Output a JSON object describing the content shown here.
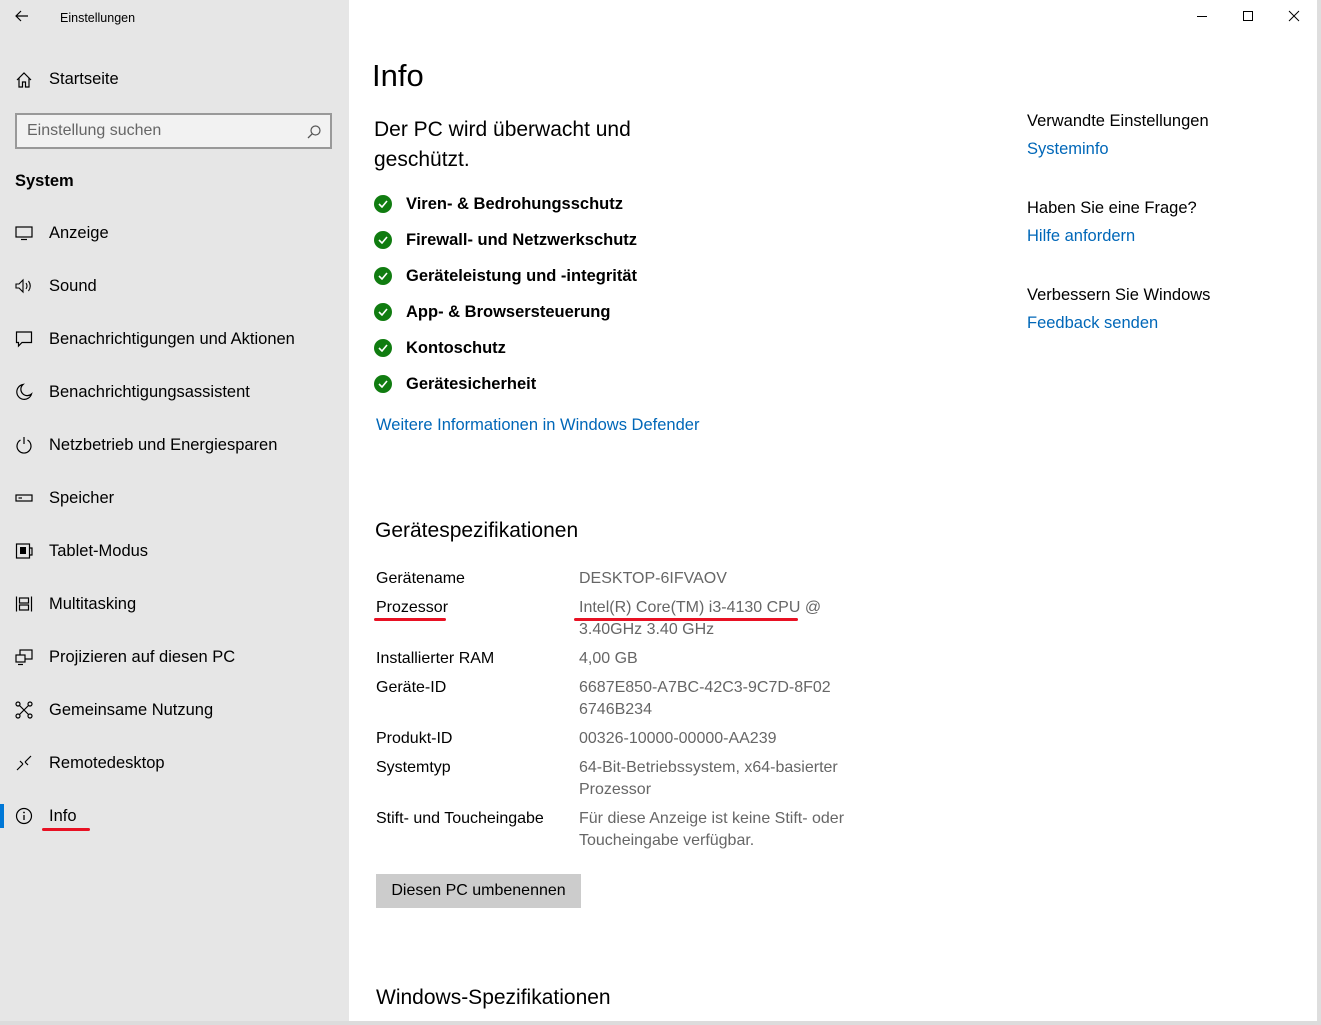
{
  "window": {
    "title": "Einstellungen"
  },
  "sidebar": {
    "home_label": "Startseite",
    "search_placeholder": "Einstellung suchen",
    "section": "System",
    "items": [
      {
        "label": "Anzeige",
        "icon": "monitor-icon"
      },
      {
        "label": "Sound",
        "icon": "speaker-icon"
      },
      {
        "label": "Benachrichtigungen und Aktionen",
        "icon": "message-icon"
      },
      {
        "label": "Benachrichtigungsassistent",
        "icon": "moon-icon"
      },
      {
        "label": "Netzbetrieb und Energiesparen",
        "icon": "power-icon"
      },
      {
        "label": "Speicher",
        "icon": "storage-icon"
      },
      {
        "label": "Tablet-Modus",
        "icon": "tablet-icon"
      },
      {
        "label": "Multitasking",
        "icon": "multitasking-icon"
      },
      {
        "label": "Projizieren auf diesen PC",
        "icon": "project-icon"
      },
      {
        "label": "Gemeinsame Nutzung",
        "icon": "share-icon"
      },
      {
        "label": "Remotedesktop",
        "icon": "remote-icon"
      },
      {
        "label": "Info",
        "icon": "info-icon",
        "active": true
      }
    ]
  },
  "main": {
    "title": "Info",
    "status_heading": "Der PC wird überwacht und geschützt.",
    "checks": [
      "Viren- & Bedrohungsschutz",
      "Firewall- und Netzwerkschutz",
      "Geräteleistung und -integrität",
      "App- & Browsersteuerung",
      "Kontoschutz",
      "Gerätesicherheit"
    ],
    "defender_link": "Weitere Informationen in Windows Defender",
    "spec_title": "Gerätespezifikationen",
    "specs": [
      {
        "key": "Gerätename",
        "value": "DESKTOP-6IFVAOV"
      },
      {
        "key": "Prozessor",
        "value": "Intel(R) Core(TM) i3-4130 CPU @ 3.40GHz   3.40 GHz"
      },
      {
        "key": "Installierter RAM",
        "value": "4,00 GB"
      },
      {
        "key": "Geräte-ID",
        "value": "6687E850-A7BC-42C3-9C7D-8F026746B234"
      },
      {
        "key": "Produkt-ID",
        "value": "00326-10000-00000-AA239"
      },
      {
        "key": "Systemtyp",
        "value": "64-Bit-Betriebssystem, x64-basierter Prozessor"
      },
      {
        "key": "Stift- und Toucheingabe",
        "value": "Für diese Anzeige ist keine Stift- oder Toucheingabe verfügbar."
      }
    ],
    "rename_button": "Diesen PC umbenennen",
    "windows_spec_title": "Windows-Spezifikationen"
  },
  "related": {
    "groups": [
      {
        "heading": "Verwandte Einstellungen",
        "link": "Systeminfo"
      },
      {
        "heading": "Haben Sie eine Frage?",
        "link": "Hilfe anfordern"
      },
      {
        "heading": "Verbessern Sie Windows",
        "link": "Feedback senden"
      }
    ]
  },
  "colors": {
    "accent": "#0078d7",
    "link": "#0067b8",
    "success": "#107c10",
    "highlight": "#e81123",
    "sidebar_bg": "#e6e6e6"
  }
}
